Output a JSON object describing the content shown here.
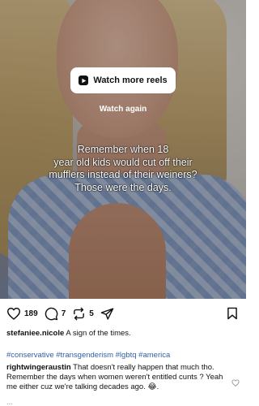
{
  "overlay": {
    "watch_more": "Watch more reels",
    "watch_again": "Watch again",
    "caption_lines": [
      "Remember when 18",
      "year old kids would cut off their",
      "mufflers instead of their weiners?",
      "Those were the days."
    ]
  },
  "actions": {
    "likes": "189",
    "comments": "7",
    "reposts": "5"
  },
  "post": {
    "username": "stefaniee.nicole",
    "caption": "A sign of the times.",
    "hashtags": "#conservative #transgenderism #lgbtq #america"
  },
  "comment": {
    "username": "rightwingeraustin",
    "text": "That doesn't really happen that much tho.  Remember the days when women weren't entitled cunts ?  Yeah me either cuz we're talking decades ago. 😂."
  },
  "more": "..."
}
